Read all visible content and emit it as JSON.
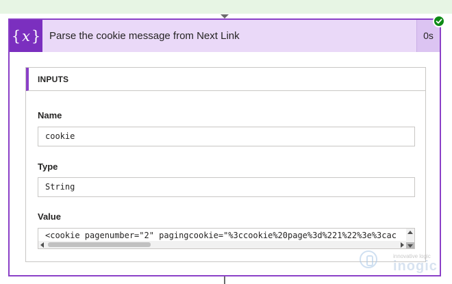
{
  "colors": {
    "accent": "#7b2fbf",
    "header_bg": "#ead9f8",
    "card_border": "#8a3fc7",
    "success": "#0e8a16"
  },
  "step": {
    "icon": "variable-icon",
    "icon_text": {
      "open": "{",
      "symbol": "x",
      "close": "}"
    },
    "title": "Parse the cookie message from Next Link",
    "duration": "0s",
    "status_icon": "check-circle-icon"
  },
  "inputs": {
    "section_title": "INPUTS",
    "fields": {
      "name": {
        "label": "Name",
        "value": "cookie"
      },
      "type": {
        "label": "Type",
        "value": "String"
      },
      "value": {
        "label": "Value",
        "value": "<cookie pagenumber=\"2\" pagingcookie=\"%3ccookie%20page%3d%221%22%3e%3cac"
      }
    }
  },
  "watermark": {
    "logo_icon": "inogic-logo-icon",
    "tagline": "innovative logic",
    "brand": "inogic"
  }
}
